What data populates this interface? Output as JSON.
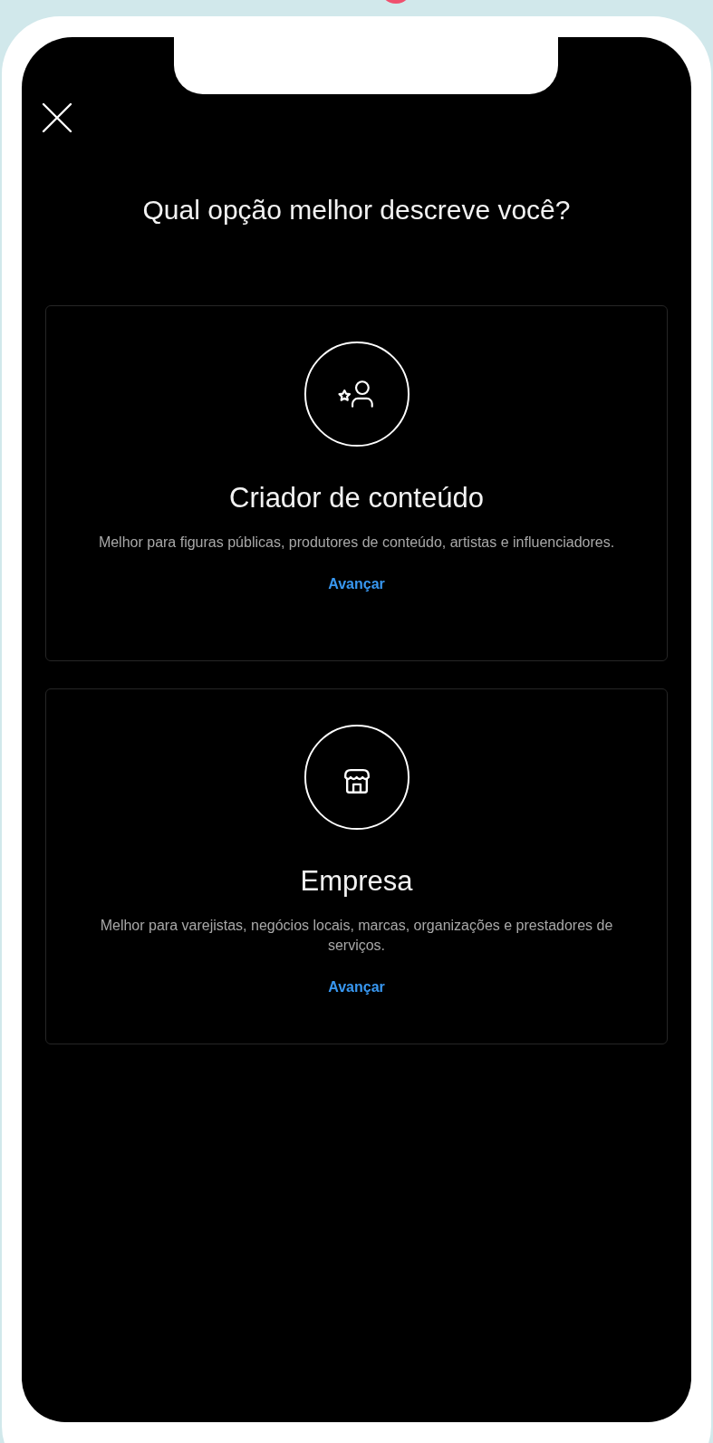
{
  "title": "Qual opção melhor descreve você?",
  "cards": [
    {
      "kind": "creator",
      "title": "Criador de conteúdo",
      "description": "Melhor para figuras públicas, produtores de conteúdo, artistas e influenciadores.",
      "action": "Avançar"
    },
    {
      "kind": "business",
      "title": "Empresa",
      "description": "Melhor para varejistas, negócios locais, marcas, organizações e prestadores de serviços.",
      "action": "Avançar"
    }
  ]
}
